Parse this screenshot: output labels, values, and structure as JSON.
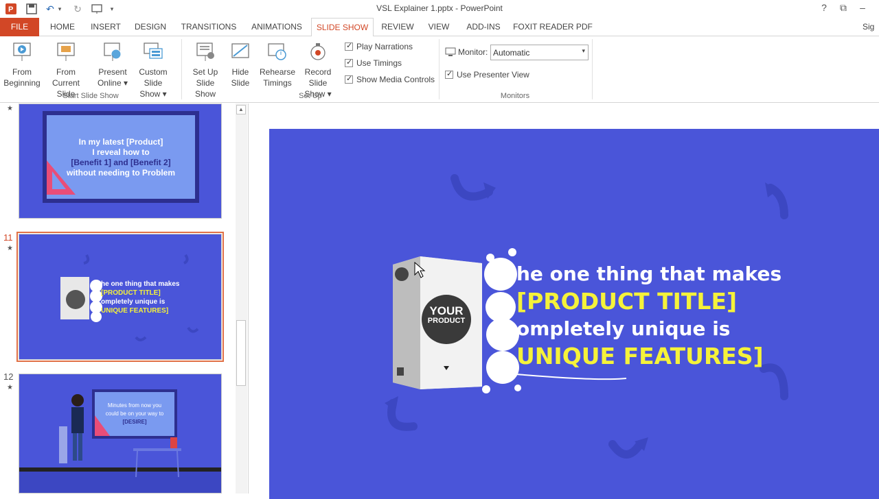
{
  "window": {
    "title": "VSL Explainer 1.pptx - PowerPoint",
    "help": "?",
    "restore": "⧉",
    "minimize": "–",
    "close": "✕"
  },
  "quick_access": {
    "undo": "↶",
    "redo": "↻",
    "more": "▾"
  },
  "tabs": [
    {
      "label": "FILE"
    },
    {
      "label": "HOME"
    },
    {
      "label": "INSERT"
    },
    {
      "label": "DESIGN"
    },
    {
      "label": "TRANSITIONS"
    },
    {
      "label": "ANIMATIONS"
    },
    {
      "label": "SLIDE SHOW"
    },
    {
      "label": "REVIEW"
    },
    {
      "label": "VIEW"
    },
    {
      "label": "ADD-INS"
    },
    {
      "label": "FOXIT READER PDF"
    }
  ],
  "sign_in": "Sig",
  "ribbon": {
    "from_beginning": [
      "From",
      "Beginning"
    ],
    "from_current": [
      "From",
      "Current Slide"
    ],
    "present_online": [
      "Present",
      "Online ▾"
    ],
    "custom_show": [
      "Custom Slide",
      "Show ▾"
    ],
    "group_start": "Start Slide Show",
    "setup_show": [
      "Set Up",
      "Slide Show"
    ],
    "hide_slide": [
      "Hide",
      "Slide"
    ],
    "rehearse": [
      "Rehearse",
      "Timings"
    ],
    "record": [
      "Record Slide",
      "Show ▾"
    ],
    "play_narrations": "Play Narrations",
    "use_timings": "Use Timings",
    "show_media": "Show Media Controls",
    "group_setup": "Set Up",
    "monitor_label": "Monitor:",
    "monitor_value": "Automatic",
    "presenter_view": "Use Presenter View",
    "group_monitors": "Monitors"
  },
  "thumbnails": [
    {
      "number": "",
      "text_lines": [
        "In my latest [Product]",
        "I reveal how to",
        "[Benefit 1] and [Benefit 2]",
        "without needing to Problem"
      ]
    },
    {
      "number": "11",
      "text_lines": [
        "he one thing that makes",
        "[PRODUCT TITLE]",
        "ompletely unique is",
        "UNIQUE FEATURES]"
      ]
    },
    {
      "number": "12",
      "text_lines": [
        "Minutes from now you",
        "could be on your way to",
        "[DESIRE]"
      ]
    }
  ],
  "main_slide": {
    "box_label_1": "YOUR",
    "box_label_2": "PRODUCT",
    "line1": "he one thing that makes",
    "line2": "[PRODUCT TITLE]",
    "line3": "ompletely unique is",
    "line4": "UNIQUE FEATURES]"
  },
  "colors": {
    "accent": "#d24726",
    "slide_bg": "#4a55d9",
    "highlight_yellow": "#f5f23a"
  }
}
